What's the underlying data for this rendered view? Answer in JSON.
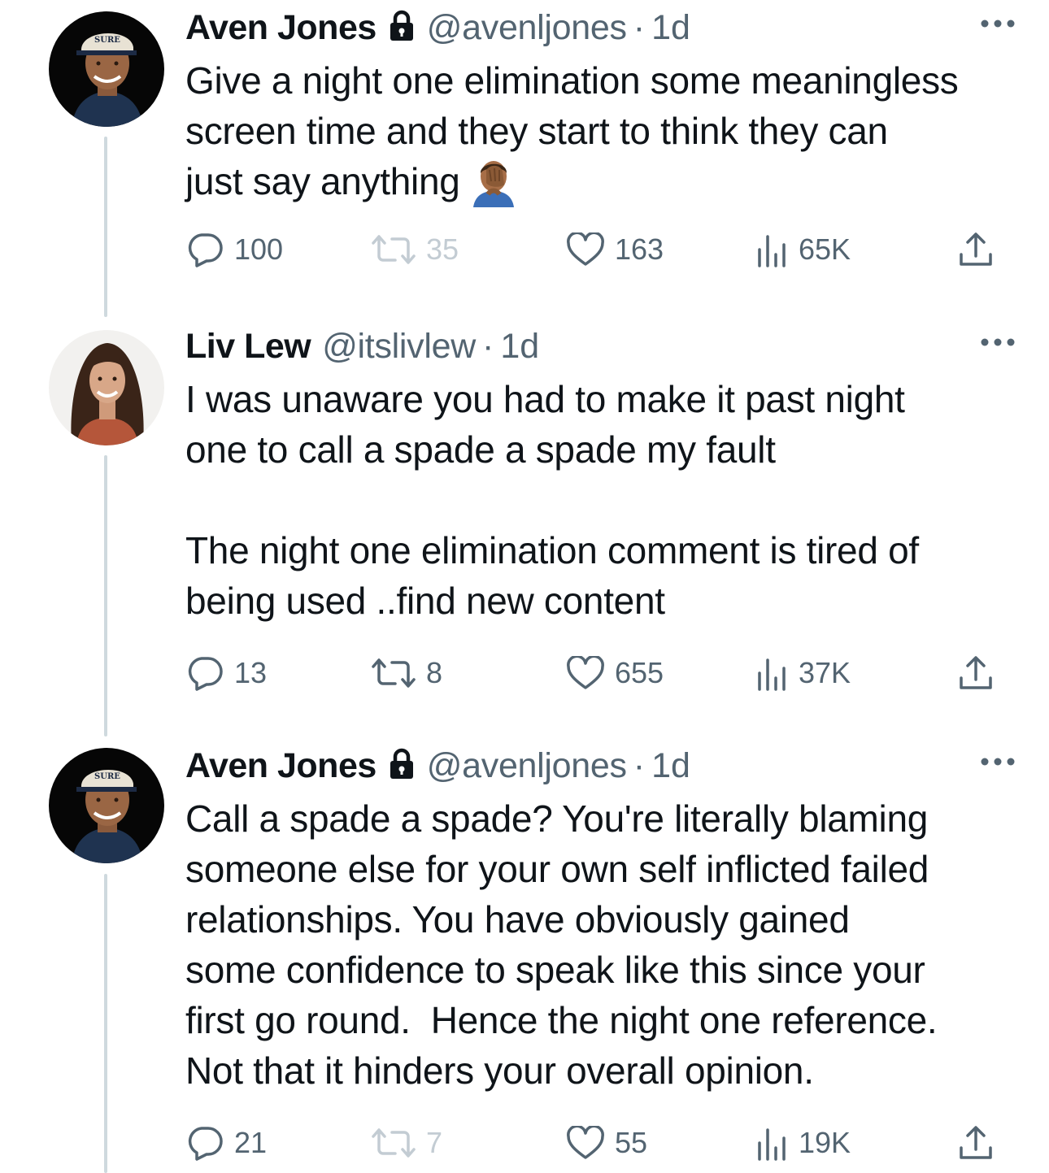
{
  "tweets": [
    {
      "name": "Aven Jones",
      "handle": "@avenljones",
      "dot": "·",
      "time": "1d",
      "locked": true,
      "text": "Give a night one elimination some meaningless\nscreen time and they start to think they can\njust say anything",
      "emoji": "man-facepalming-emoji",
      "stats": {
        "replies": "100",
        "retweets": "35",
        "likes": "163",
        "views": "65K"
      },
      "retweets_faded": true
    },
    {
      "name": "Liv Lew",
      "handle": "@itslivlew",
      "dot": "·",
      "time": "1d",
      "locked": false,
      "text": "I was unaware you had to make it past night\none to call a spade a spade my fault\n\nThe night one elimination comment is tired of\nbeing used ..find new content",
      "stats": {
        "replies": "13",
        "retweets": "8",
        "likes": "655",
        "views": "37K"
      },
      "retweets_faded": false
    },
    {
      "name": "Aven Jones",
      "handle": "@avenljones",
      "dot": "·",
      "time": "1d",
      "locked": true,
      "text": "Call a spade a spade? You're literally blaming\nsomeone else for your own self inflicted failed\nrelationships. You have obviously gained\nsome confidence to speak like this since your\nfirst go round.  Hence the night one reference.\nNot that it hinders your overall opinion.",
      "stats": {
        "replies": "21",
        "retweets": "7",
        "likes": "55",
        "views": "19K"
      },
      "retweets_faded": true
    }
  ],
  "colors": {
    "text": "#0f1419",
    "secondary": "#536471",
    "faded": "#c3ccd3",
    "thread_line": "#cfd9de"
  },
  "icons": [
    "lock-icon",
    "more-icon",
    "reply-icon",
    "retweet-icon",
    "like-icon",
    "views-icon",
    "share-icon"
  ]
}
